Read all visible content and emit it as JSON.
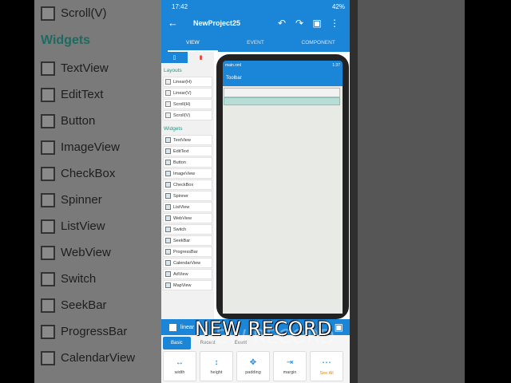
{
  "background_left": {
    "items": [
      {
        "label": "Scroll(V)"
      },
      {
        "header": "Widgets"
      },
      {
        "label": "TextView"
      },
      {
        "label": "EditText"
      },
      {
        "label": "Button"
      },
      {
        "label": "ImageView"
      },
      {
        "label": "CheckBox"
      },
      {
        "label": "Spinner"
      },
      {
        "label": "ListView"
      },
      {
        "label": "WebView"
      },
      {
        "label": "Switch"
      },
      {
        "label": "SeekBar"
      },
      {
        "label": "ProgressBar"
      },
      {
        "label": "CalendarView"
      }
    ]
  },
  "status": {
    "time": "17:42",
    "right": "42%"
  },
  "appbar": {
    "title": "NewProject25"
  },
  "tabs": [
    "VIEW",
    "EVENT",
    "COMPONENT"
  ],
  "palette": {
    "layouts_header": "Layouts",
    "layouts": [
      "Linear(H)",
      "Linear(V)",
      "Scroll(H)",
      "Scroll(V)"
    ],
    "widgets_header": "Widgets",
    "widgets": [
      "TextView",
      "EditText",
      "Button",
      "ImageView",
      "CheckBox",
      "Spinner",
      "ListView",
      "WebView",
      "Switch",
      "SeekBar",
      "ProgressBar",
      "CalendarView",
      "AdView",
      "MapView"
    ]
  },
  "preview": {
    "file": "main.xml",
    "time": "1:37",
    "toolbar": "Toolbar"
  },
  "bottom": {
    "selected": "linear",
    "tabs": [
      "Basic",
      "Recent",
      "Event"
    ],
    "buttons": [
      {
        "label": "width"
      },
      {
        "label": "height"
      },
      {
        "label": "padding"
      },
      {
        "label": "margin"
      },
      {
        "label": "See All"
      }
    ]
  },
  "overlay": {
    "text": "NEW RECORD"
  },
  "colors": {
    "accent": "#1b86d8",
    "section": "#1d9a86"
  }
}
